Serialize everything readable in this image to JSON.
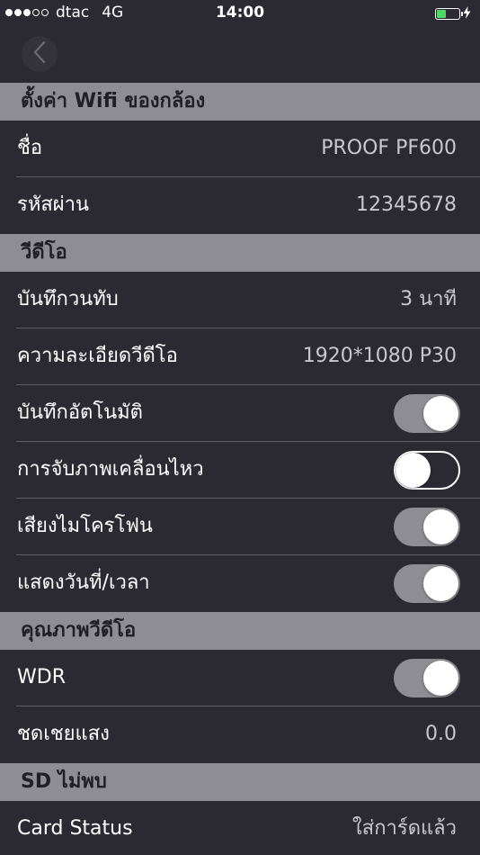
{
  "status_bar": {
    "carrier": "dtac",
    "network": "4G",
    "time": "14:00",
    "signal_bars": 3,
    "signal_total": 5,
    "battery_level": 0.45,
    "battery_color": "#4cd964",
    "charging_icon": "bolt-icon"
  },
  "nav": {
    "back_icon": "chevron-left-icon"
  },
  "sections": [
    {
      "title": "ตั้งค่า Wifi ของกล้อง",
      "rows": [
        {
          "label": "ชื่อ",
          "type": "value",
          "value": "PROOF PF600"
        },
        {
          "label": "รหัสผ่าน",
          "type": "value",
          "value": "12345678"
        }
      ]
    },
    {
      "title": "วีดีโอ",
      "rows": [
        {
          "label": "บันทึกวนทับ",
          "type": "value",
          "value": "3 นาที"
        },
        {
          "label": "ความละเอียดวีดีโอ",
          "type": "value",
          "value": "1920*1080 P30"
        },
        {
          "label": "บันทึกอัตโนมัติ",
          "type": "toggle",
          "on": true
        },
        {
          "label": "การจับภาพเคลื่อนไหว",
          "type": "toggle",
          "on": false
        },
        {
          "label": "เสียงไมโครโฟน",
          "type": "toggle",
          "on": true
        },
        {
          "label": "แสดงวันที่/เวลา",
          "type": "toggle",
          "on": true
        }
      ]
    },
    {
      "title": "คุณภาพวีดีโอ",
      "rows": [
        {
          "label": "WDR",
          "type": "toggle",
          "on": true
        },
        {
          "label": "ชดเชยแสง",
          "type": "value",
          "value": "0.0"
        }
      ]
    },
    {
      "title": "SD ไม่พบ",
      "rows": [
        {
          "label": "Card Status",
          "type": "value",
          "value": "ใส่การ์ดแล้ว"
        }
      ]
    }
  ]
}
